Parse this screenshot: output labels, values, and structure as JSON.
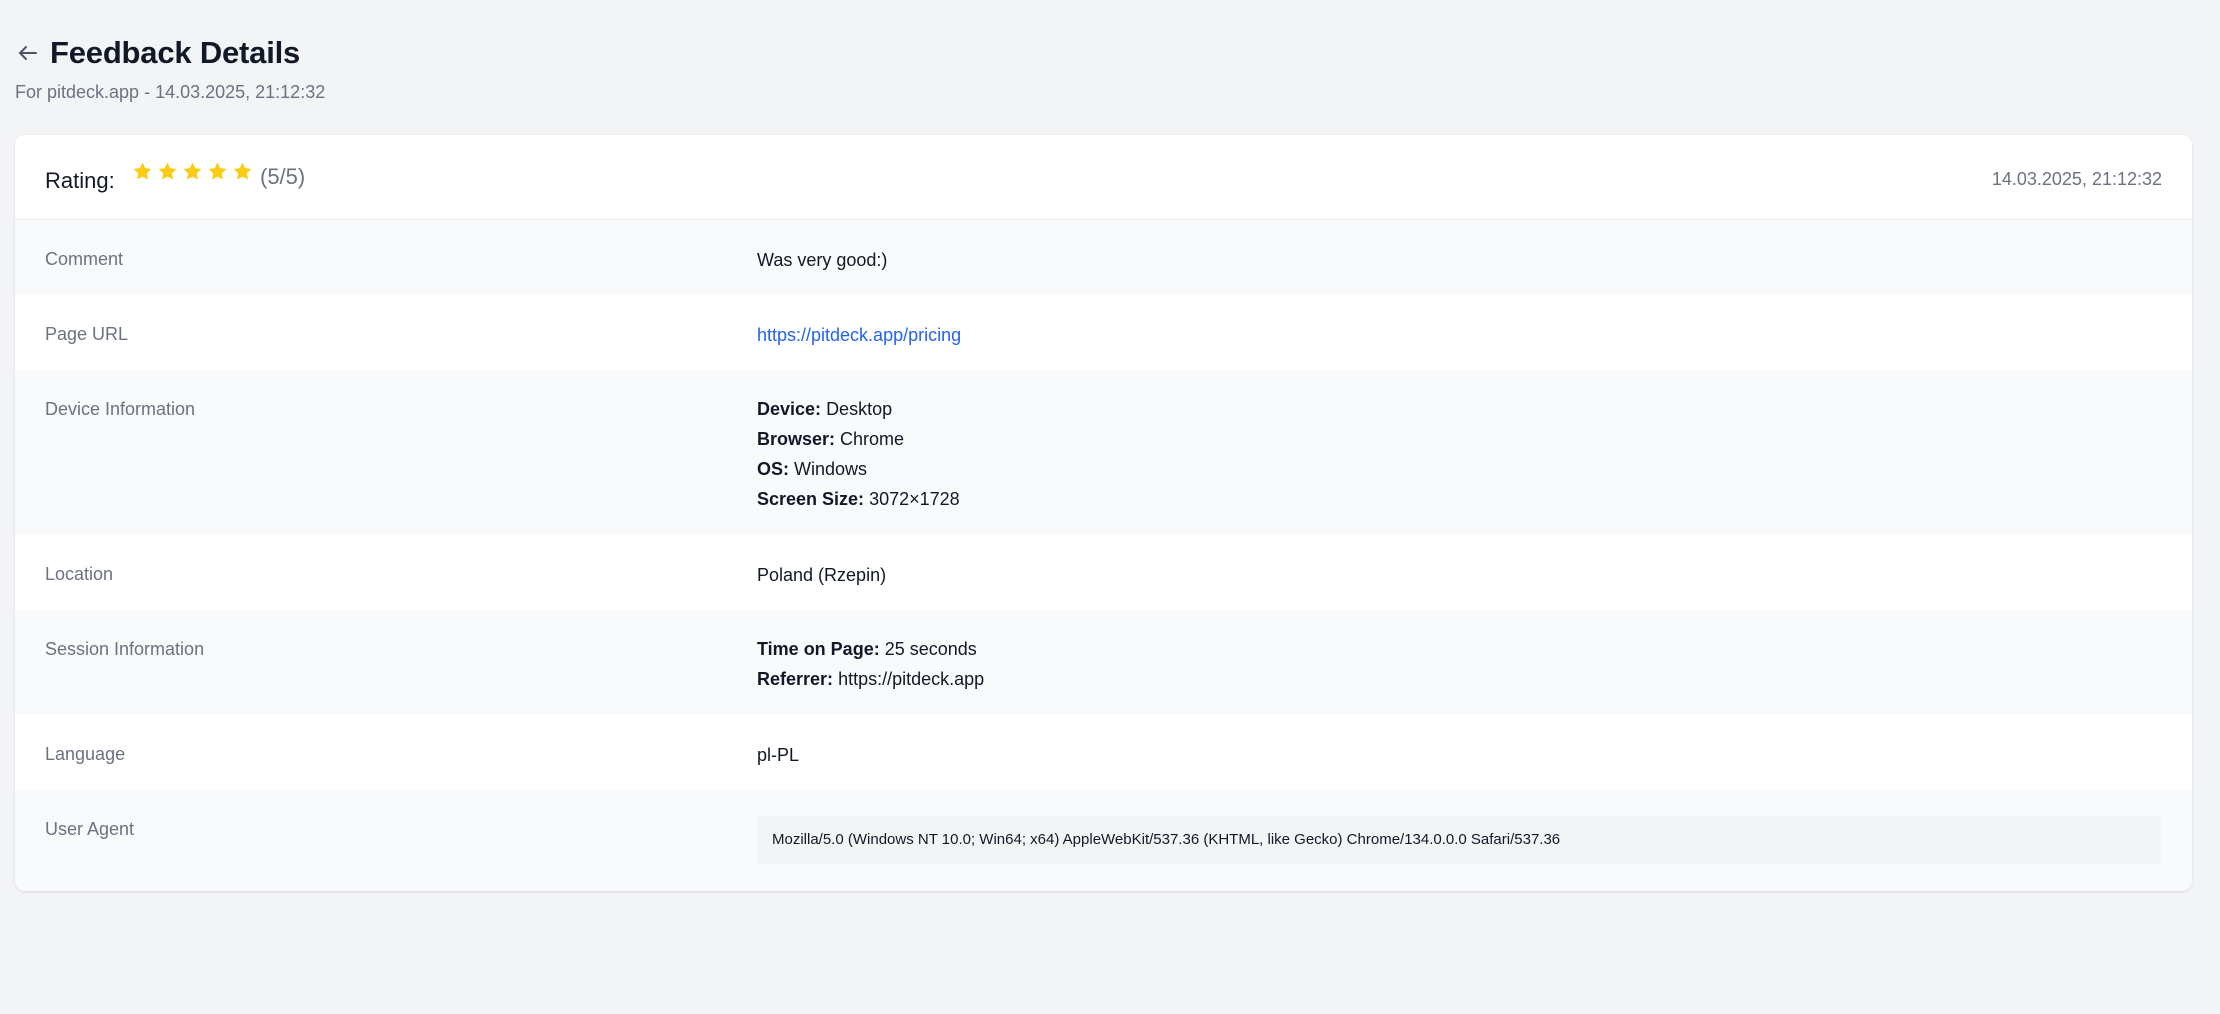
{
  "header": {
    "title": "Feedback Details",
    "subtitle": "For pitdeck.app - 14.03.2025, 21:12:32",
    "back_icon": "arrow-left-icon"
  },
  "rating": {
    "label": "Rating:",
    "value": 5,
    "max": 5,
    "count_text": "(5/5)",
    "star_color": "#facc15",
    "timestamp": "14.03.2025, 21:12:32"
  },
  "details": {
    "comment": {
      "label": "Comment",
      "value": "Was very good:)"
    },
    "page_url": {
      "label": "Page URL",
      "value": "https://pitdeck.app/pricing"
    },
    "device": {
      "label": "Device Information",
      "device_key": "Device:",
      "device_value": "Desktop",
      "browser_key": "Browser:",
      "browser_value": "Chrome",
      "os_key": "OS:",
      "os_value": "Windows",
      "screen_key": "Screen Size:",
      "screen_value": "3072×1728"
    },
    "location": {
      "label": "Location",
      "value": "Poland (Rzepin)"
    },
    "session": {
      "label": "Session Information",
      "time_key": "Time on Page:",
      "time_value": "25 seconds",
      "referrer_key": "Referrer:",
      "referrer_value": "https://pitdeck.app"
    },
    "language": {
      "label": "Language",
      "value": "pl-PL"
    },
    "user_agent": {
      "label": "User Agent",
      "value": "Mozilla/5.0 (Windows NT 10.0; Win64; x64) AppleWebKit/537.36 (KHTML, like Gecko) Chrome/134.0.0.0 Safari/537.36"
    }
  },
  "colors": {
    "background": "#f3f4f6",
    "card": "#ffffff",
    "row_alt": "#f9fafb",
    "link": "#2563eb",
    "muted_text": "#6b7280",
    "star": "#facc15"
  }
}
